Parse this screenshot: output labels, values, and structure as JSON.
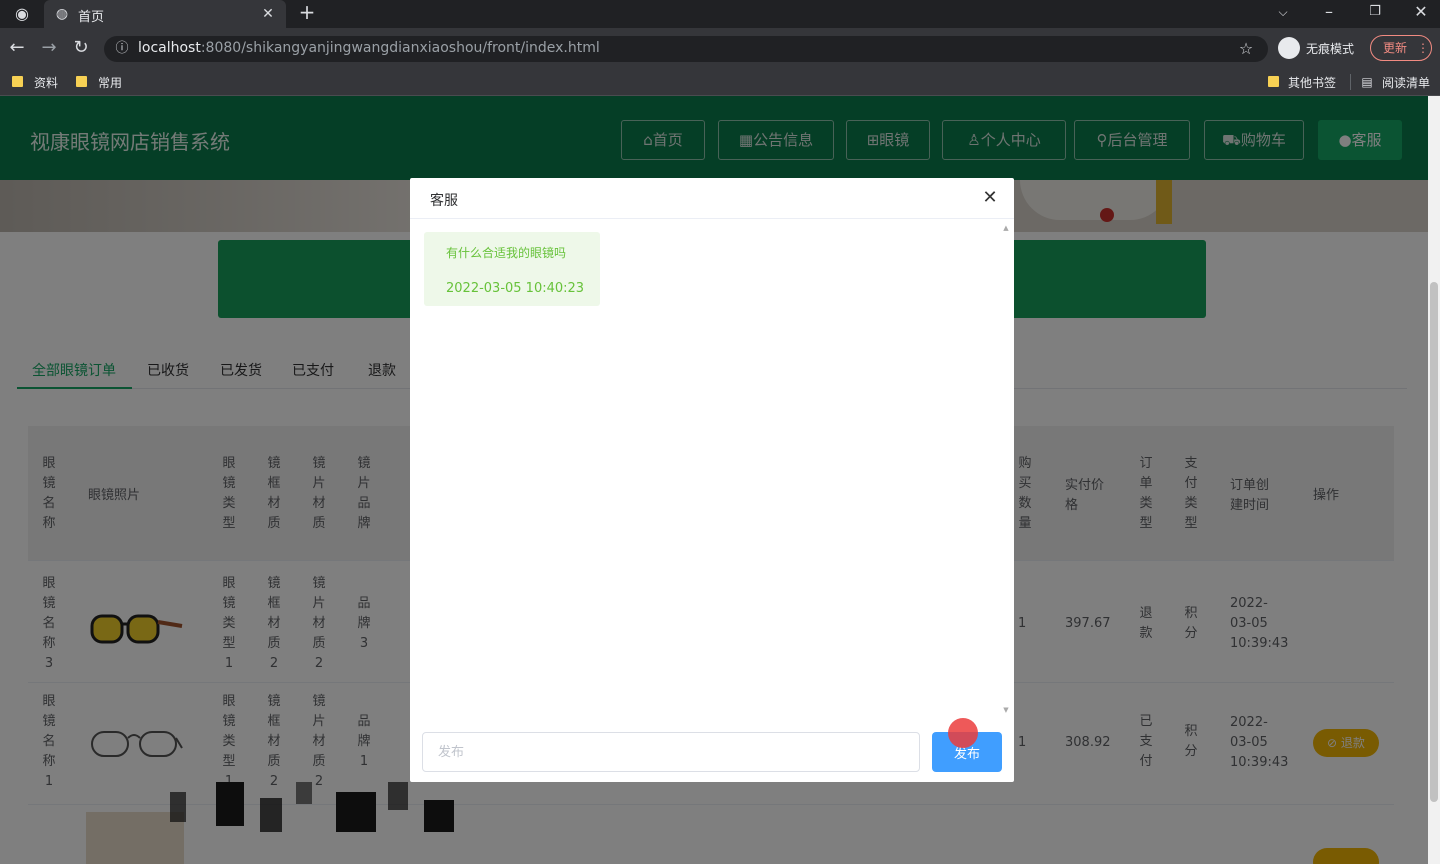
{
  "browser": {
    "tab_title": "首页",
    "url_host": "localhost",
    "url_path": ":8080/shikangyanjingwangdianxiaoshou/front/index.html",
    "incognito_label": "无痕模式",
    "update_label": "更新",
    "bookmarks": [
      "资料",
      "常用"
    ],
    "other_bookmarks": "其他书签",
    "reading_list": "阅读清单"
  },
  "site": {
    "title": "视康眼镜网店销售系统",
    "nav": [
      "首页",
      "公告信息",
      "眼镜",
      "个人中心",
      "后台管理",
      "购物车",
      "客服"
    ]
  },
  "orders": {
    "tabs": [
      "全部眼镜订单",
      "已收货",
      "已发货",
      "已支付",
      "退款"
    ],
    "headers_left": [
      {
        "text": "眼镜名称",
        "vertical": true
      },
      {
        "text": "眼镜照片",
        "vertical": false
      },
      {
        "text": "眼镜类型",
        "vertical": true
      },
      {
        "text": "镜框材质",
        "vertical": true
      },
      {
        "text": "镜片材质",
        "vertical": true
      },
      {
        "text": "镜片品牌",
        "vertical": true
      }
    ],
    "headers_right": [
      {
        "text": "购买数量",
        "vertical": true
      },
      {
        "text": "实付价格",
        "vertical": false
      },
      {
        "text": "订单类型",
        "vertical": true
      },
      {
        "text": "支付类型",
        "vertical": true
      },
      {
        "text": "订单创建时间",
        "vertical": false
      },
      {
        "text": "操作",
        "vertical": false
      }
    ],
    "rows": [
      {
        "name": "眼镜名称3",
        "type": "眼镜类型1",
        "frame": "镜框材质2",
        "lens": "镜片材质2",
        "brand": "品牌3",
        "qty": "1",
        "price": "397.67",
        "order_type": "退款",
        "pay_type": "积分",
        "created": "2022-03-05 10:39:43",
        "action": ""
      },
      {
        "name": "眼镜名称1",
        "type": "眼镜类型1",
        "frame": "镜框材质2",
        "lens": "镜片材质2",
        "brand": "品牌1",
        "qty": "1",
        "price": "308.92",
        "order_type": "已支付",
        "pay_type": "积分",
        "created": "2022-03-05 10:39:43",
        "action": "退款"
      }
    ]
  },
  "dialog": {
    "title": "客服",
    "message": "有什么合适我的眼镜吗",
    "timestamp": "2022-03-05 10:40:23",
    "input_placeholder": "发布",
    "send_label": "发布"
  }
}
